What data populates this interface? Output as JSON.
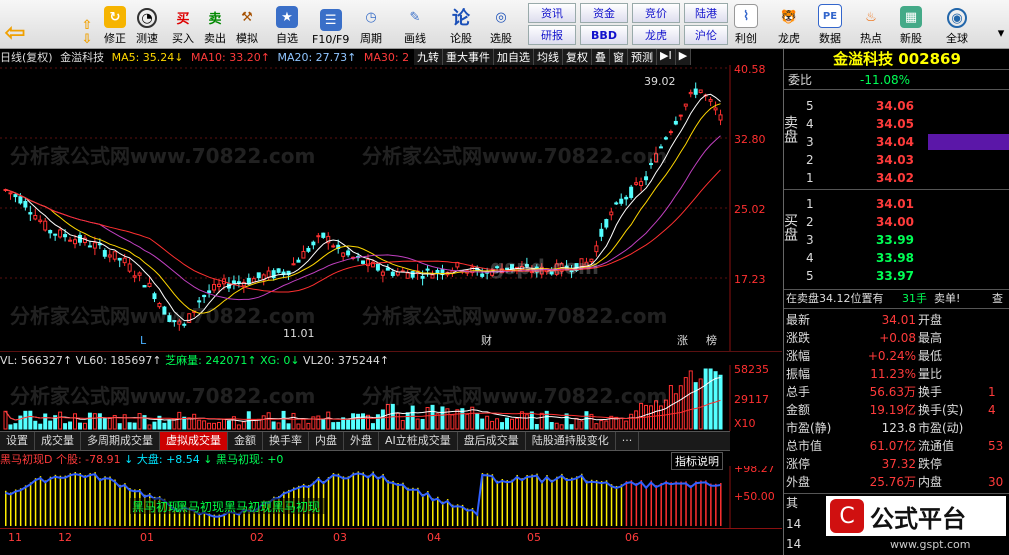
{
  "toolbar": {
    "buttons": [
      {
        "label": "修正",
        "icon": "refresh-icon"
      },
      {
        "label": "测速",
        "icon": "clock-icon"
      },
      {
        "label": "买入",
        "icon": "buy-icon",
        "text": "买"
      },
      {
        "label": "卖出",
        "icon": "sell-icon",
        "text": "卖"
      },
      {
        "label": "模拟",
        "icon": "hammer-icon"
      },
      {
        "label": "自选",
        "icon": "star-icon"
      },
      {
        "label": "F10/F9",
        "icon": "doc-icon"
      },
      {
        "label": "周期",
        "icon": "period-icon"
      },
      {
        "label": "画线",
        "icon": "pen-icon"
      },
      {
        "label": "论股",
        "icon": "discuss-icon",
        "text": "论"
      },
      {
        "label": "选股",
        "icon": "filter-icon"
      },
      {
        "label": "利创",
        "icon": "chart-icon"
      },
      {
        "label": "龙虎",
        "icon": "tiger-icon"
      },
      {
        "label": "数据",
        "icon": "pe-icon",
        "text": "PE"
      },
      {
        "label": "热点",
        "icon": "fire-icon"
      },
      {
        "label": "新股",
        "icon": "newstock-icon"
      },
      {
        "label": "全球",
        "icon": "globe-icon"
      }
    ],
    "small": [
      "资讯",
      "资金",
      "竞价",
      "陆港",
      "研报",
      "BBD",
      "龙虎",
      "沪伦"
    ]
  },
  "chart": {
    "period": "日线(复权)",
    "name": "金溢科技",
    "ma5": "MA5: 35.24↓",
    "ma10": "MA10: 33.20↑",
    "ma20": "MA20: 27.73↑",
    "ma30": "MA30: 2",
    "tools": [
      "九转",
      "重大事件",
      "加自选",
      "均线",
      "复权",
      "叠",
      "窗",
      "预测"
    ],
    "yaxis": [
      "40.58",
      "32.80",
      "25.02",
      "17.23"
    ],
    "high_label": "39.02",
    "low_label": "11.01",
    "markers": [
      "L",
      "财",
      "涨",
      "榜"
    ]
  },
  "volume": {
    "vl": "VL: 566327↑",
    "vl60": "VL60: 185697↑",
    "zhi": "芝麻量: 242071↑",
    "xg": "XG: 0↓",
    "vl20": "VL20: 375244↑",
    "yaxis": [
      "58235",
      "29117",
      "X10"
    ]
  },
  "tabs": [
    "设置",
    "成交量",
    "多周期成交量",
    "虚拟成交量",
    "金额",
    "换手率",
    "内盘",
    "外盘",
    "AI立桩成交量",
    "盘后成交量",
    "陆股通持股变化",
    "···"
  ],
  "active_tab": "虚拟成交量",
  "indicator": {
    "name": "黑马初现D",
    "ge": "个股: -78.91",
    "dp": "↓ 大盘: +8.54",
    "hm": "↓ 黑马初现: +0",
    "help": "指标说明",
    "yaxis": [
      "+98.27",
      "+50.00"
    ],
    "labels": [
      "黑马初现",
      "黑马初现",
      "黑马初现",
      "黑马初现"
    ]
  },
  "xaxis": [
    "11",
    "12",
    "01",
    "02",
    "03",
    "04",
    "05",
    "06"
  ],
  "quote": {
    "title": "金溢科技 002869",
    "weibi_label": "委比",
    "weibi_val": "-11.08%",
    "sell_side": "卖盘",
    "buy_side": "买盘",
    "sells": [
      {
        "n": "5",
        "p": "34.06"
      },
      {
        "n": "4",
        "p": "34.05"
      },
      {
        "n": "3",
        "p": "34.04"
      },
      {
        "n": "2",
        "p": "34.03"
      },
      {
        "n": "1",
        "p": "34.02"
      }
    ],
    "buys": [
      {
        "n": "1",
        "p": "34.01"
      },
      {
        "n": "2",
        "p": "34.00"
      },
      {
        "n": "3",
        "p": "33.99"
      },
      {
        "n": "4",
        "p": "33.98"
      },
      {
        "n": "5",
        "p": "33.97"
      }
    ],
    "note": "在卖盘34.12位置有",
    "note_val": "31手",
    "note_act": "卖单!",
    "note_extra": "查",
    "stats": [
      {
        "l": "最新",
        "v": "34.01",
        "l2": "开盘",
        "v2": ""
      },
      {
        "l": "涨跌",
        "v": "+0.08",
        "l2": "最高",
        "v2": ""
      },
      {
        "l": "涨幅",
        "v": "+0.24%",
        "l2": "最低",
        "v2": ""
      },
      {
        "l": "振幅",
        "v": "11.23%",
        "l2": "量比",
        "v2": ""
      },
      {
        "l": "总手",
        "v": "56.63万",
        "l2": "换手",
        "v2": "1"
      },
      {
        "l": "金额",
        "v": "19.19亿",
        "l2": "换手(实)",
        "v2": "4"
      },
      {
        "l": "市盈(静)",
        "v": "123.8",
        "l2": "市盈(动)",
        "v2": ""
      },
      {
        "l": "总市值",
        "v": "61.07亿",
        "l2": "流通值",
        "v2": "53"
      },
      {
        "l": "涨停",
        "v": "37.32",
        "l2": "跌停",
        "v2": ""
      },
      {
        "l": "外盘",
        "v": "25.76万",
        "l2": "内盘",
        "v2": "30"
      }
    ],
    "bottom": [
      "其",
      "14",
      "14"
    ]
  },
  "watermarks": [
    "分析家公式网www.70822.com",
    "gspd.com",
    "公式平台",
    "www.gspt.com"
  ]
}
